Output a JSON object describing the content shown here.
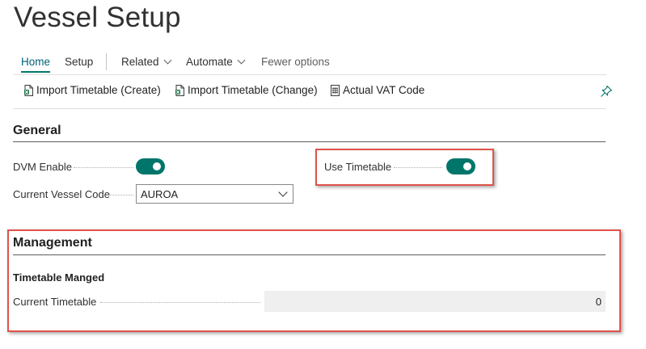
{
  "page": {
    "title": "Vessel Setup"
  },
  "actionbar": {
    "tabs": [
      {
        "label": "Home",
        "selected": true
      },
      {
        "label": "Setup"
      },
      {
        "label": "Related"
      },
      {
        "label": "Automate"
      },
      {
        "label": "Fewer options"
      }
    ]
  },
  "promoted_actions": [
    {
      "label": "Import Timetable (Create)",
      "icon": "excel-import-icon"
    },
    {
      "label": "Import Timetable (Change)",
      "icon": "excel-import-icon"
    },
    {
      "label": "Actual VAT Code",
      "icon": "report-icon"
    }
  ],
  "general": {
    "title": "General",
    "dvm_enable": {
      "label": "DVM Enable",
      "value": true
    },
    "current_vessel_code": {
      "label": "Current Vessel Code",
      "value": "AUROA"
    },
    "use_timetable": {
      "label": "Use Timetable",
      "value": true
    }
  },
  "management": {
    "title": "Management",
    "group_title": "Timetable Manged",
    "current_timetable": {
      "label": "Current Timetable",
      "value": "0"
    }
  },
  "colors": {
    "accent": "#00766b",
    "highlight": "#e0524a",
    "link": "#00607a"
  }
}
